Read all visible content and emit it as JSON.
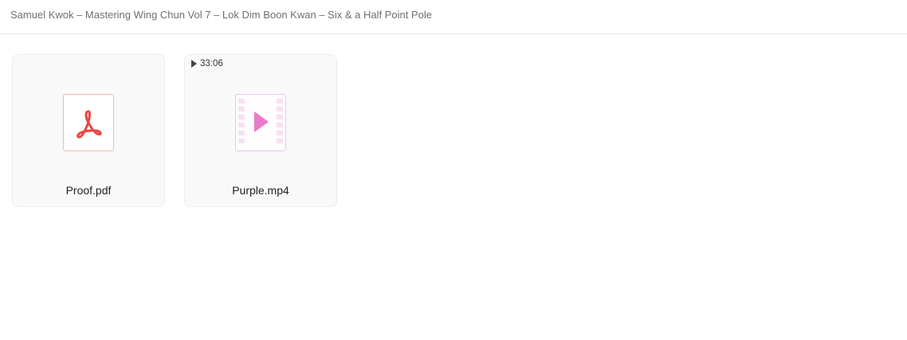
{
  "header": {
    "breadcrumb": "Samuel Kwok – Mastering Wing Chun Vol 7 – Lok Dim Boon Kwan – Six & a Half Point Pole"
  },
  "files": [
    {
      "name": "Proof.pdf",
      "type": "pdf",
      "icon": "pdf-icon",
      "accent": "#ef4444"
    },
    {
      "name": "Purple.mp4",
      "type": "video",
      "icon": "video-file-icon",
      "duration": "33:06",
      "accent": "#e879c9"
    }
  ]
}
